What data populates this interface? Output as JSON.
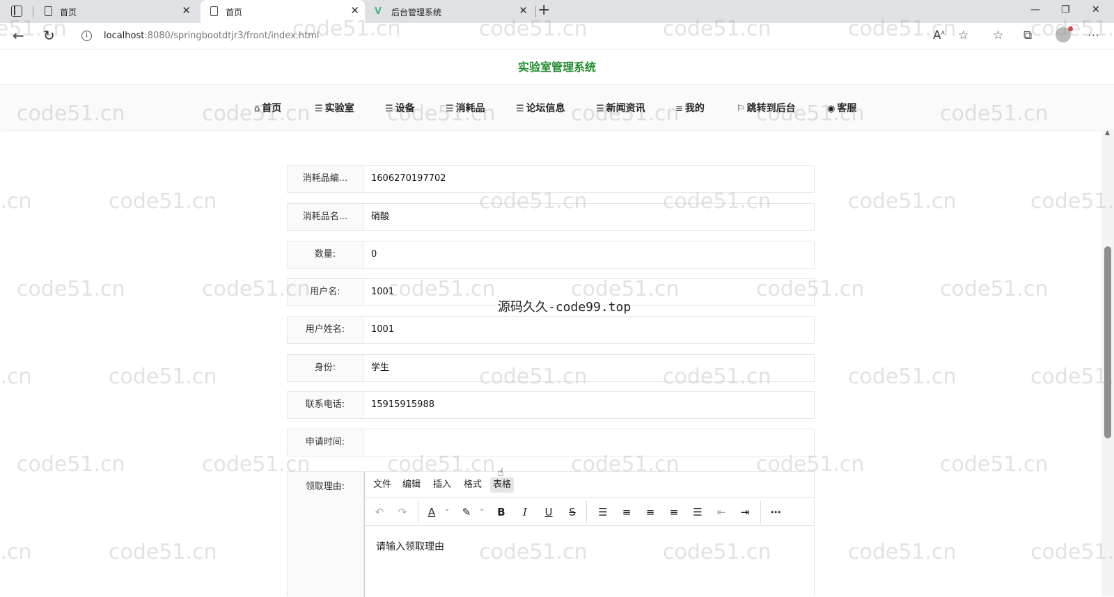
{
  "browser": {
    "tabs": [
      {
        "title": "首页",
        "active": false
      },
      {
        "title": "首页",
        "active": true
      },
      {
        "title": "后台管理系统",
        "active": false
      }
    ],
    "url_host": "localhost",
    "url_rest": ":8080/springbootdtjr3/front/index.html"
  },
  "site": {
    "title": "实验室管理系统",
    "nav": [
      {
        "icon": "home-icon",
        "label": "首页"
      },
      {
        "icon": "layers-icon",
        "label": "实验室"
      },
      {
        "icon": "layers-icon",
        "label": "设备"
      },
      {
        "icon": "layers-icon",
        "label": "消耗品"
      },
      {
        "icon": "layers-icon",
        "label": "论坛信息"
      },
      {
        "icon": "layers-icon",
        "label": "新闻资讯"
      },
      {
        "icon": "list-icon",
        "label": "我的"
      },
      {
        "icon": "flag-icon",
        "label": "跳转到后台"
      },
      {
        "icon": "chat-icon",
        "label": "客服"
      }
    ]
  },
  "form": {
    "fields": [
      {
        "label": "消耗品编...",
        "value": "1606270197702"
      },
      {
        "label": "消耗品名...",
        "value": "硝酸"
      },
      {
        "label": "数量:",
        "value": "0"
      },
      {
        "label": "用户名:",
        "value": "1001"
      },
      {
        "label": "用户姓名:",
        "value": "1001"
      },
      {
        "label": "身份:",
        "value": "学生"
      },
      {
        "label": "联系电话:",
        "value": "15915915988"
      },
      {
        "label": "申请时间:",
        "value": ""
      }
    ],
    "reason_label": "领取理由:",
    "editor": {
      "menu": [
        "文件",
        "编辑",
        "插入",
        "格式",
        "表格"
      ],
      "placeholder": "请输入领取理由"
    }
  },
  "watermark": {
    "site": "code51.cn",
    "center": "源码久久-code99.top"
  }
}
